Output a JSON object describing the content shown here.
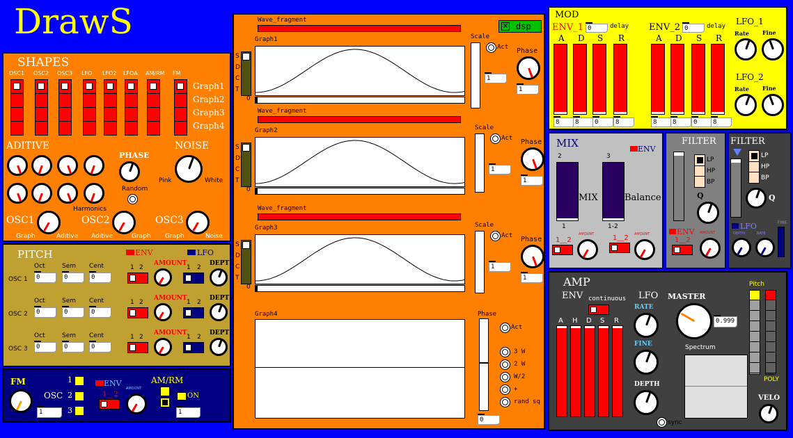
{
  "app": {
    "title": "DrawS",
    "dsp_label": "dsp"
  },
  "shapes": {
    "title": "SHAPES",
    "columns": [
      "OSC1",
      "OSC2",
      "OSC3",
      "LFO",
      "LFO2",
      "LFOA",
      "AM/RM",
      "FM"
    ],
    "graphs": [
      "Graph1",
      "Graph2",
      "Graph3",
      "Graph4"
    ],
    "aditive": "ADITIVE",
    "phase": "PHASE",
    "noise": "NOISE",
    "random": "Random",
    "pink": "Pink",
    "white": "White",
    "harmonics": "Harmonics",
    "osc": [
      {
        "name": "OSC1",
        "l": "Graph",
        "r": "Aditive"
      },
      {
        "name": "OSC2",
        "l": "Aditive",
        "r": "Graph"
      },
      {
        "name": "OSC3",
        "l": "Graph",
        "r": "Noise"
      }
    ]
  },
  "pitch": {
    "title": "PITCH",
    "env": "ENV",
    "lfo": "LFO",
    "amount": "AMOUNT",
    "depth": "DEPTH",
    "oct": "Oct",
    "sem": "Sem",
    "cent": "Cent",
    "one": "1",
    "two": "2",
    "rows": [
      {
        "label": "OSC 1",
        "oct": "0",
        "sem": "0",
        "cent": "0"
      },
      {
        "label": "OSC 2",
        "oct": "0",
        "sem": "0",
        "cent": "0"
      },
      {
        "label": "OSC 3",
        "oct": "0",
        "sem": "0",
        "cent": "0"
      }
    ]
  },
  "fm": {
    "title": "FM",
    "osc": "OSC",
    "n1": "1",
    "n2": "2",
    "n3": "3",
    "env": "ENV",
    "env_sel": "1__2",
    "amount": "AMOUNT",
    "amrm": "AM/RM",
    "on": "ON",
    "box1": "1",
    "box2": "1"
  },
  "wave": {
    "fragment": "Wave_fragment",
    "graphs": [
      "Graph1",
      "Graph2",
      "Graph3",
      "Graph4"
    ],
    "sdct": [
      "S",
      "D",
      "C",
      "T"
    ],
    "zero": "0",
    "scale": "Scale",
    "act": "Act",
    "phase": "Phase",
    "one": "1",
    "g4_opts": [
      "3 W",
      "2 W",
      "W/2",
      "+",
      "rand sq"
    ],
    "g4_val": "0"
  },
  "mod": {
    "title": "MOD",
    "env1": "ENV_1",
    "env2": "ENV_2",
    "delay": "delay",
    "delay1": "0",
    "delay2": "0",
    "adsr": [
      "A",
      "D",
      "S",
      "R"
    ],
    "vals1": [
      "8",
      "8",
      "0",
      "8"
    ],
    "vals2": [
      "8",
      "8",
      "0",
      "8"
    ],
    "lfo1": "LFO_1",
    "lfo2": "LFO_2",
    "rate": "Rate",
    "fine": "Fine"
  },
  "mix": {
    "title": "MIX",
    "env": "ENV",
    "n2": "2",
    "n3": "3",
    "n1": "1",
    "n12": "1-2",
    "mix": "MIX",
    "balance": "Balance",
    "amount": "AMOUNT",
    "sel": "1__2"
  },
  "filter1": {
    "title": "FILTER",
    "lp": "LP",
    "hp": "HP",
    "bp": "BP",
    "q": "Q",
    "env": "ENV",
    "amount": "AMOUNT",
    "sel": "1__2"
  },
  "filter2": {
    "title": "FILTER",
    "lp": "LP",
    "hp": "HP",
    "bp": "BP",
    "q": "Q",
    "lfo": "LFO",
    "depth": "DEPTH",
    "rate": "RATE",
    "fine": "FINE"
  },
  "amp": {
    "title": "AMP",
    "env": "ENV",
    "continuous": "continuous",
    "ahdsr": [
      "A",
      "H",
      "D",
      "S",
      "R"
    ],
    "lfo": "LFO",
    "rate": "RATE",
    "fine": "FINE",
    "depth": "DEPTH",
    "master": "MASTER",
    "master_val": "0.999",
    "spectrum": "Spectrum",
    "sync": "sync",
    "pitch": "Pitch",
    "poly": "POLY",
    "velo": "VELO"
  },
  "colors": {
    "bg": "#0000ff",
    "orange": "#ff8000",
    "yellow": "#ffff00",
    "olive": "#c0a030",
    "gray": "#c0c0c0",
    "dark": "#404040",
    "red": "#ff0000",
    "navy": "#000080"
  }
}
